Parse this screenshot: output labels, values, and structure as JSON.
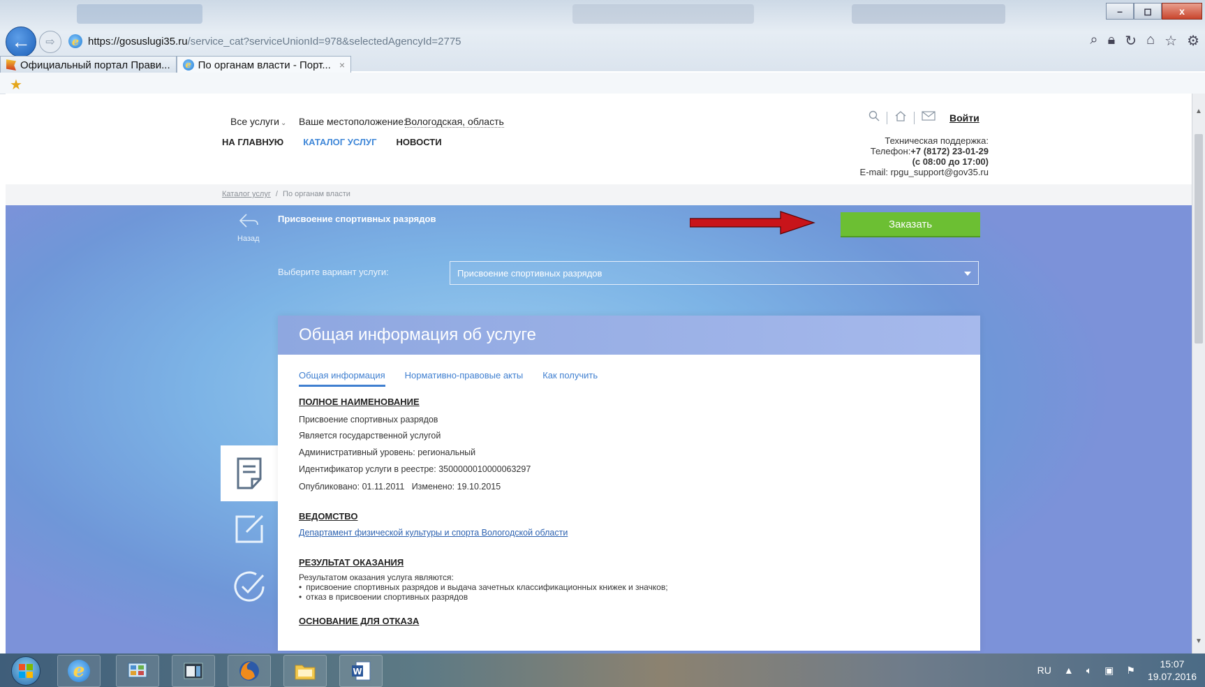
{
  "browser": {
    "url_host": "https://gosuslugi35.ru",
    "url_path": "/service_cat?serviceUnionId=978&selectedAgencyId=2775",
    "tabs": [
      {
        "label": "Официальный портал Прави..."
      },
      {
        "label": "По органам власти - Порт...",
        "close": "×"
      }
    ],
    "window_controls": {
      "minimize": "–",
      "maximize": "◻",
      "close": "x"
    }
  },
  "header": {
    "all_services": "Все услуги",
    "location_label": "Ваше местоположение:",
    "location_value": "Вологодская, область",
    "nav": [
      "НА ГЛАВНУЮ",
      "КАТАЛОГ УСЛУГ",
      "НОВОСТИ"
    ],
    "login": "Войти",
    "support": {
      "title": "Техническая поддержка:",
      "phone_label": "Телефон:",
      "phone": "+7 (8172) 23-01-29",
      "hours": "(с 08:00 до 17:00)",
      "email": "E-mail: rpgu_support@gov35.ru"
    }
  },
  "breadcrumb": {
    "root": "Каталог услуг",
    "sep": "/",
    "current": "По органам власти"
  },
  "service": {
    "back_label": "Назад",
    "title": "Присвоение спортивных разрядов",
    "order_button": "Заказать",
    "variant_label": "Выберите вариант услуги:",
    "variant_selected": "Присвоение спортивных разрядов"
  },
  "card": {
    "title": "Общая информация об услуге",
    "tabs": [
      "Общая информация",
      "Нормативно-правовые акты",
      "Как получить"
    ],
    "full_name_heading": "ПОЛНОЕ НАИМЕНОВАНИЕ",
    "full_name_lines": [
      "Присвоение спортивных разрядов",
      "Является государственной услугой",
      "Административный уровень: региональный",
      "Идентификатор услуги в реестре: 3500000010000063297",
      "Опубликовано: 01.11.2011   Изменено: 19.10.2015"
    ],
    "agency_heading": "ВЕДОМСТВО",
    "agency_link": "Департамент физической культуры и спорта Вологодской области",
    "result_heading": "РЕЗУЛЬТАТ ОКАЗАНИЯ",
    "result_intro": "Результатом оказания услуга являются:",
    "result_items": [
      "присвоение спортивных разрядов и выдача зачетных классификационных книжек и значков;",
      "отказ в присвоении спортивных разрядов"
    ],
    "refusal_heading": "ОСНОВАНИЕ ДЛЯ ОТКАЗА"
  },
  "taskbar": {
    "lang": "RU",
    "time": "15:07",
    "date": "19.07.2016"
  },
  "colors": {
    "accent": "#3f87d8",
    "order_button": "#6cbf33",
    "card_header": "#8ea7e0",
    "arrow": "#c8141a"
  }
}
